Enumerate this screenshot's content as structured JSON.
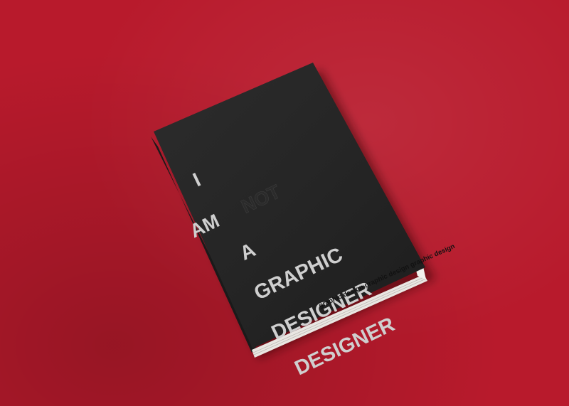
{
  "scene": {
    "background_color": "#b81a2c",
    "book_cover_color": "#262626",
    "cover_text_color": "#cfcfcf"
  },
  "cover": {
    "line1": "I",
    "line2_word1": "AM",
    "line2_word2": "NOT",
    "line3": "A",
    "line4": "GRAPHIC",
    "line5": "DESIGNER",
    "line6": "DESIGNER"
  },
  "page_edge": {
    "text": "graphic design graphic design graphic design"
  }
}
